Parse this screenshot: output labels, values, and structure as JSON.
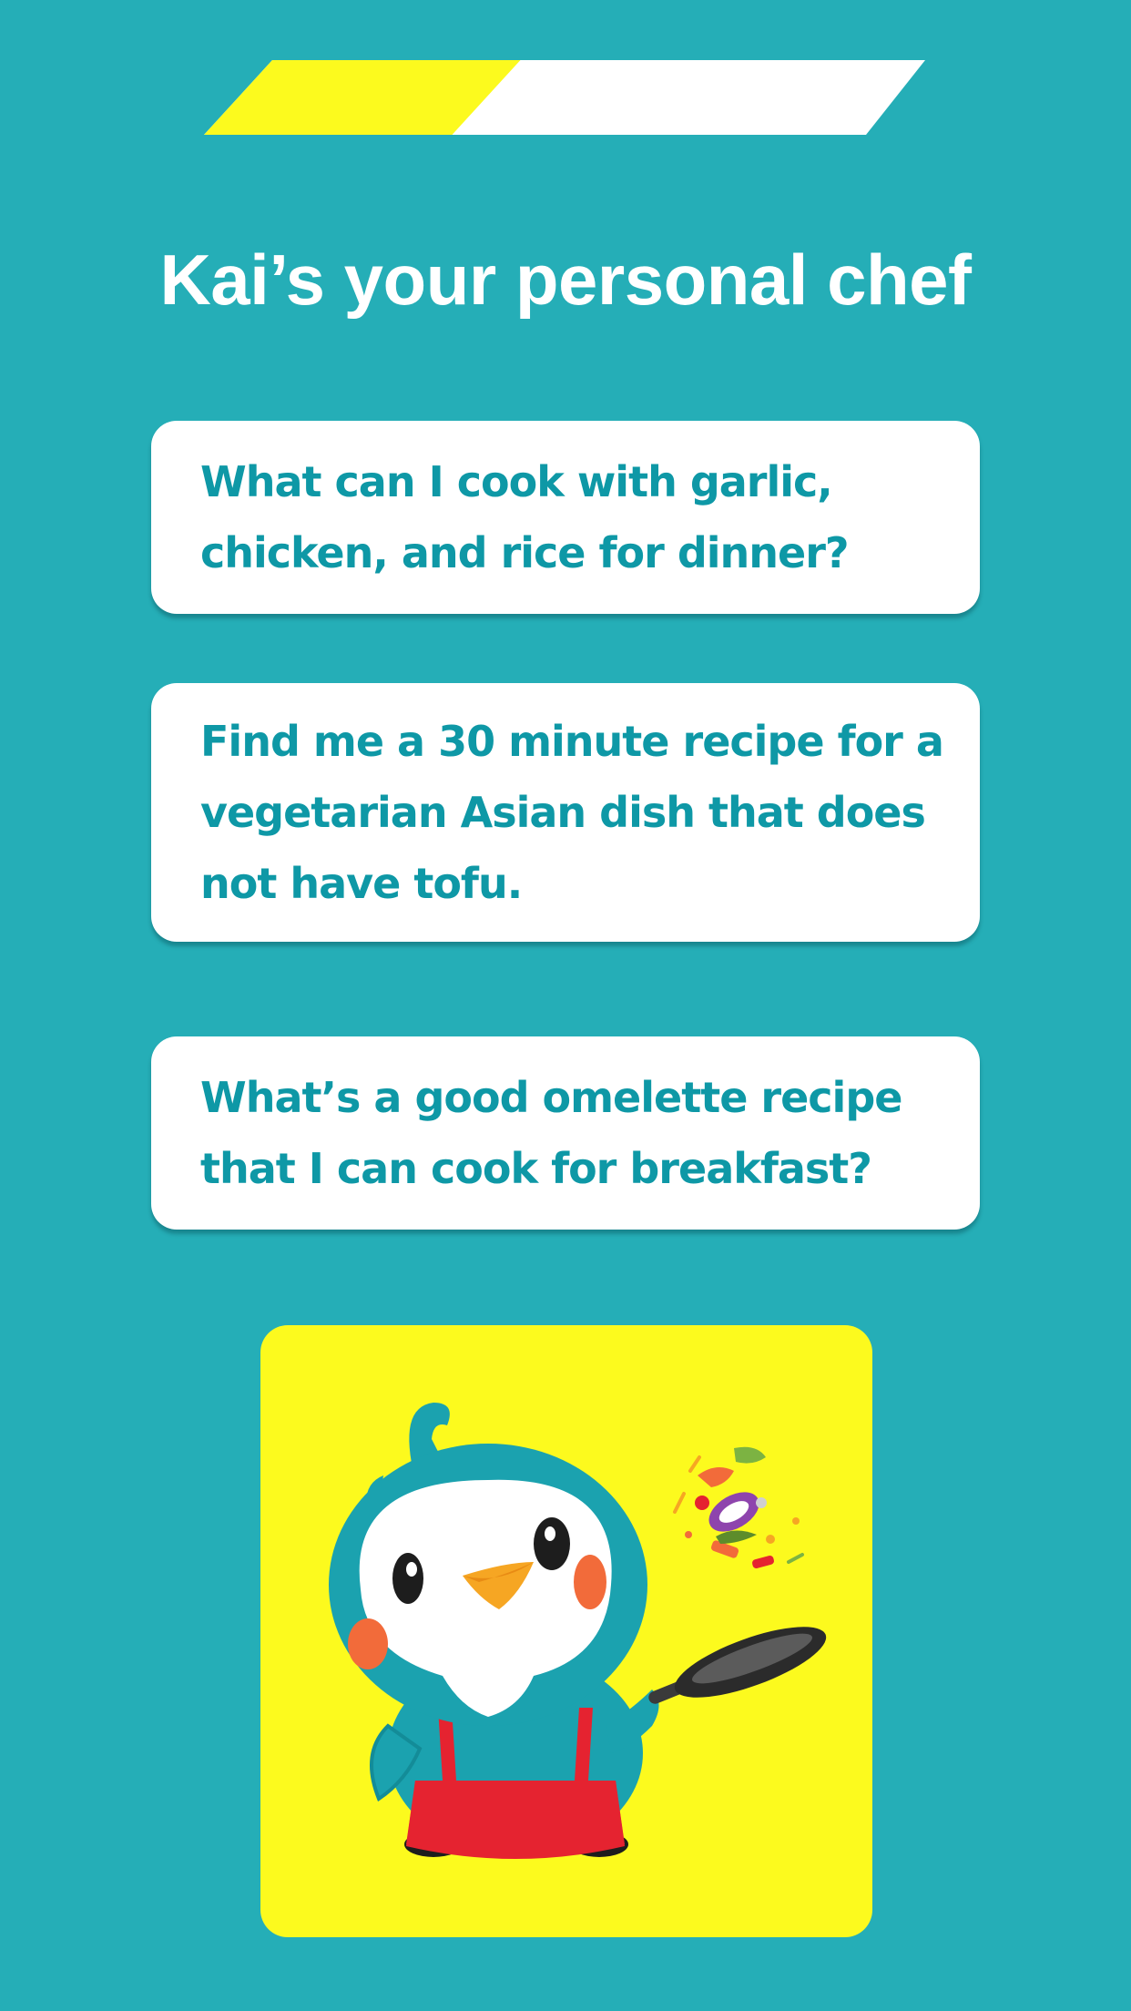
{
  "progress": {
    "value": 0.38,
    "fill_color": "#FCFA1E",
    "track_color": "#FFFFFF"
  },
  "header": {
    "title": "Kai’s your personal chef"
  },
  "suggestions": [
    {
      "text": "What can I cook with garlic,\nchicken, and rice for dinner?"
    },
    {
      "text": "Find me a 30 minute recipe for a\nvegetarian Asian dish that does\nnot have tofu."
    },
    {
      "text": "What’s a good omelette recipe\nthat I can cook for breakfast?"
    }
  ],
  "mascot": {
    "icon": "kai-chef-bird-illustration"
  },
  "colors": {
    "background": "#25AEB7",
    "card_text": "#0E98A6",
    "accent_yellow": "#FCFA1E",
    "apron_red": "#E52330"
  }
}
